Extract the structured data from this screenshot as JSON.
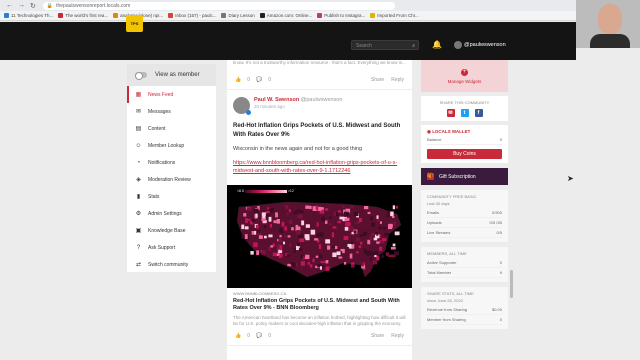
{
  "browser": {
    "url": "thepaulswensonreport.locals.com",
    "bookmarks": [
      {
        "label": "11 Technologies Th...",
        "color": "#2a7fd4"
      },
      {
        "label": "The world's first rea...",
        "color": "#c92a3a"
      },
      {
        "label": "analyzer (clone) npi...",
        "color": "#e08a00"
      },
      {
        "label": "Inbox (157) - paulc...",
        "color": "#db4437"
      },
      {
        "label": "Diary Lesson",
        "color": "#777777"
      },
      {
        "label": "Amazon.com: Online...",
        "color": "#222222"
      },
      {
        "label": "Publish to Instagra...",
        "color": "#c13584"
      },
      {
        "label": "Imported From Chr...",
        "color": "#e0b400"
      }
    ]
  },
  "header": {
    "logo_text": "TPS",
    "search_placeholder": "Search",
    "username": "@paulwswenson"
  },
  "sidebar": {
    "view_as_member": "View as member",
    "items": [
      {
        "label": "News Feed",
        "icon": "grid-icon",
        "glyph": "▦",
        "active": true
      },
      {
        "label": "Messages",
        "icon": "chat-icon",
        "glyph": "✉",
        "active": false
      },
      {
        "label": "Content",
        "icon": "content-icon",
        "glyph": "▤",
        "active": false
      },
      {
        "label": "Member Lookup",
        "icon": "person-icon",
        "glyph": "☺",
        "active": false
      },
      {
        "label": "Notifications",
        "icon": "bell-icon",
        "glyph": "◔",
        "active": false
      },
      {
        "label": "Moderation Review",
        "icon": "shield-icon",
        "glyph": "◈",
        "active": false
      },
      {
        "label": "Stats",
        "icon": "stats-icon",
        "glyph": "▮",
        "active": false
      },
      {
        "label": "Admin Settings",
        "icon": "gear-icon",
        "glyph": "⚙",
        "active": false
      },
      {
        "label": "Knowledge Base",
        "icon": "book-icon",
        "glyph": "▣",
        "active": false
      },
      {
        "label": "Ask Support",
        "icon": "question-icon",
        "glyph": "?",
        "active": false
      },
      {
        "label": "Switch community",
        "icon": "switch-icon",
        "glyph": "⇄",
        "active": false
      }
    ]
  },
  "feed": {
    "prev_text": "know. It's not a trustworthy information resource - that's a fact. Everything we know is...",
    "prev_actions": {
      "likes": "0",
      "comments": "0",
      "share": "Share",
      "reply": "Reply"
    },
    "post": {
      "author": "Paul W. Swenson",
      "handle": "@paulwswenson",
      "time": "20 minutes ago",
      "title": "Red-Hot Inflation Grips Pockets of U.S. Midwest and South With Rates Over 9%",
      "body": "Wisconsin in the news again and not for a good thing",
      "link": "https://www.bnnbloomberg.ca/red-hot-inflation-grips-pockets-of-u-s-midwest-and-south-with-rates-over-9-1.1712246",
      "map_legend_low": "<8.5",
      "map_legend_high": ">12",
      "source": "WWW.BNNBLOOMBERG.CA",
      "link_title": "Red-Hot Inflation Grips Pockets of U.S. Midwest and South With Rates Over 9% - BNN Bloomberg",
      "link_desc": "The American heartland has become an inflation hotbed, highlighting how difficult it will be for U.S. policy makers to cool decades-high inflation that is gripping the economy.",
      "actions": {
        "likes": "0",
        "comments": "0",
        "share": "Share",
        "reply": "Reply"
      }
    }
  },
  "right": {
    "manage_widgets": "Manage Widgets",
    "share_title": "SHARE THIS COMMUNITY",
    "wallet_title": "LOCALS WALLET",
    "balance_label": "Balance",
    "balance_value": "0",
    "buy_coins": "Buy Coins",
    "gift": "Gift Subscription",
    "community_title": "COMMUNITY FREE BASIC",
    "community_sub": "Last 30 days",
    "community_rows": [
      {
        "label": "Emails",
        "value": "0/300"
      },
      {
        "label": "Uploads",
        "value": "0/5 GB"
      },
      {
        "label": "Live Streams",
        "value": "0/5"
      }
    ],
    "members_title": "MEMBERS, ALL TIME",
    "members_rows": [
      {
        "label": "Active Supporter",
        "value": "0"
      },
      {
        "label": "Total Member",
        "value": "9"
      }
    ],
    "share_stats_title": "SHARE STATS, ALL TIME",
    "share_stats_sub": "since June 28, 2020",
    "share_rows": [
      {
        "label": "Revenue from Sharing",
        "value": "$0.00"
      },
      {
        "label": "Member from Sharing",
        "value": "0"
      }
    ]
  }
}
